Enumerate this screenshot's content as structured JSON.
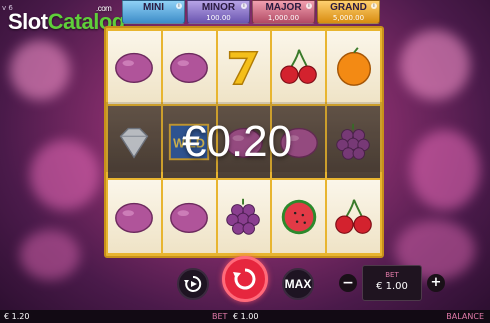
{
  "header": {
    "version": "v 6",
    "logo_slot": "Slot",
    "logo_catalog": "Catalog",
    "logo_com": ".com"
  },
  "jackpots": [
    {
      "name": "MINI",
      "value": "",
      "color": "#3d8cc8"
    },
    {
      "name": "MINOR",
      "value": "100.00",
      "color": "#6a55b0"
    },
    {
      "name": "MAJOR",
      "value": "1,000.00",
      "color": "#b24a64"
    },
    {
      "name": "GRAND",
      "value": "5,000.00",
      "color": "#d88c10"
    }
  ],
  "reels": [
    [
      "plum",
      "plum",
      "seven",
      "cherry",
      "orange"
    ],
    [
      "diamond",
      "wild",
      "plum",
      "plum",
      "grapes"
    ],
    [
      "plum",
      "plum",
      "grapes",
      "watermelon",
      "cherry"
    ]
  ],
  "win": {
    "amount": "€0.20"
  },
  "controls": {
    "autoplay_icon": "autoplay-icon",
    "spin_icon": "spin-icon",
    "max_label": "MAX",
    "minus_label": "−",
    "plus_label": "+",
    "bet_label": "BET",
    "bet_value": "€ 1.00"
  },
  "status_bar": {
    "cash": "€ 1.20",
    "bet_label": "BET",
    "bet_value": "€ 1.00",
    "balance_label": "BALANCE"
  },
  "colors": {
    "accent_pink": "#e07aa8",
    "spin_red": "#e6263e",
    "reel_frame": "#e8b530",
    "logo_green": "#5fce3a"
  }
}
